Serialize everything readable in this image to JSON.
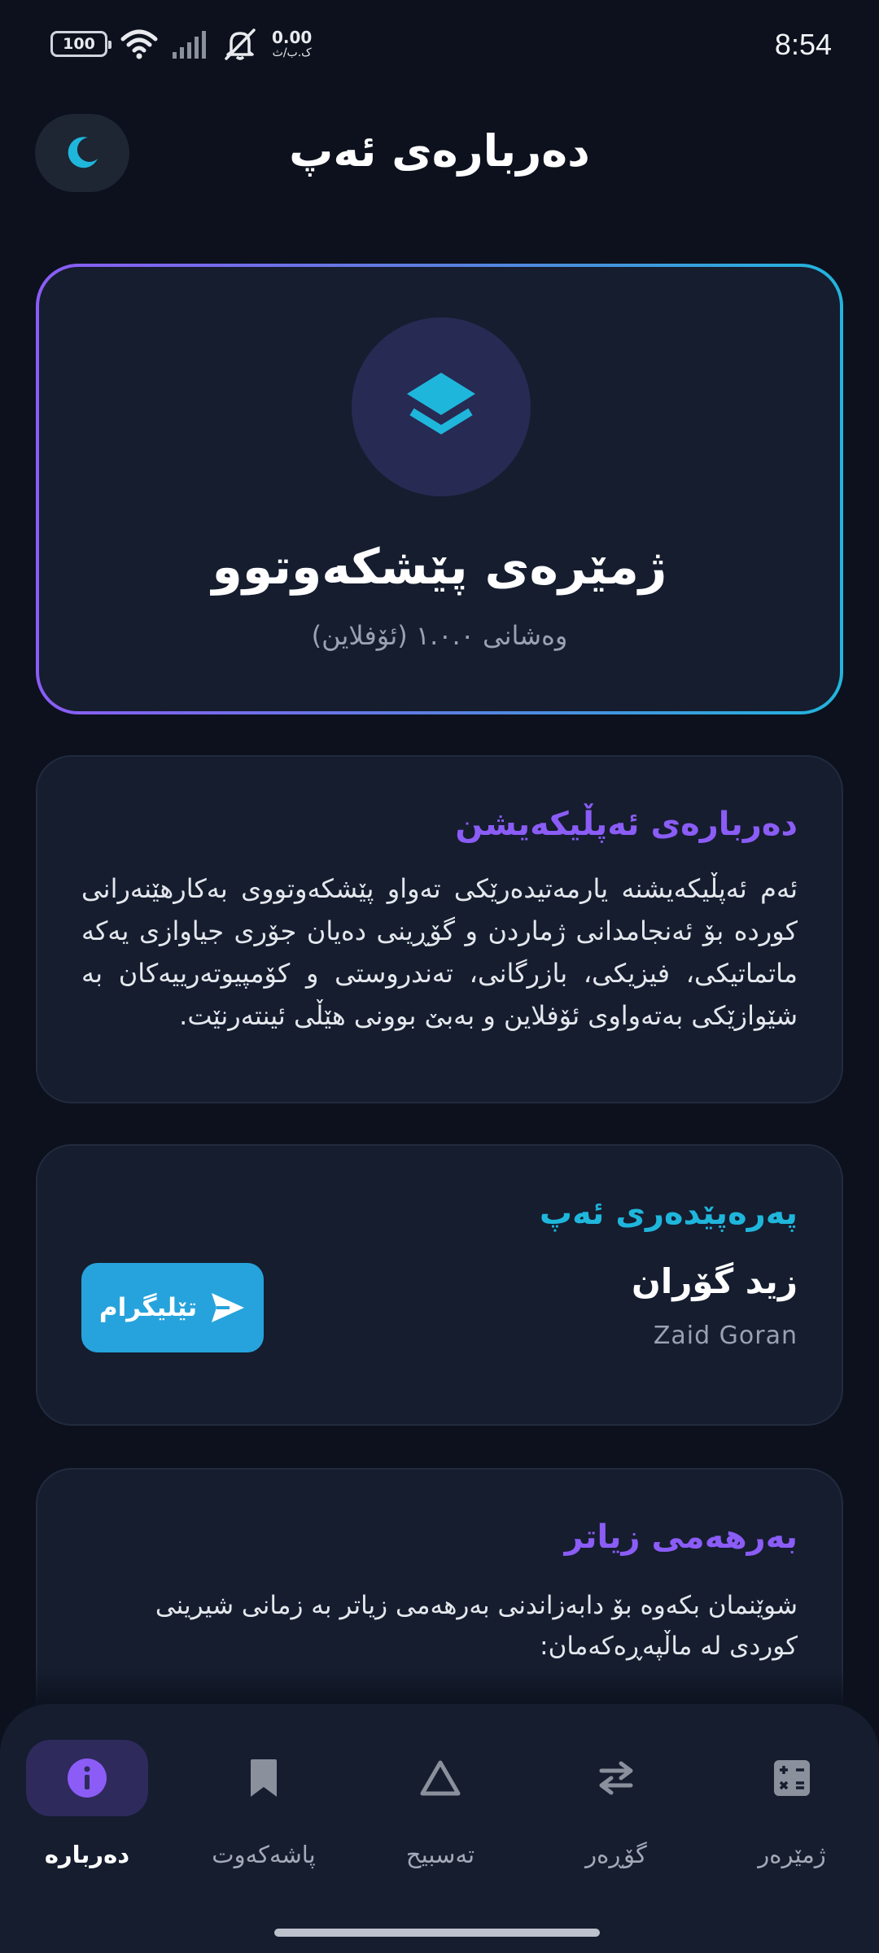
{
  "status_bar": {
    "battery": "100",
    "net_speed": "0.00",
    "net_unit": "ک.ب/ث",
    "time": "8:54",
    "icons": [
      "wifi-icon",
      "signal-icon",
      "mute-bell-icon"
    ]
  },
  "header": {
    "title": "دەربارەی ئەپ",
    "theme_icon": "moon-icon"
  },
  "hero": {
    "icon": "layers-icon",
    "app_name": "ژمێرەی پێشکەوتوو",
    "version": "وەشانی ١.٠.٠ (ئۆفلاین)"
  },
  "about": {
    "heading": "دەربارەی ئەپڵیکەیشن",
    "text": "ئەم ئەپڵیکەیشنە یارمەتیدەرێکی تەواو پێشکەوتووی بەکارهێنەرانی کوردە بۆ ئەنجامدانی ژماردن و گۆڕینی دەیان جۆری جیاوازی یەکە ماتماتیکی، فیزیکی، بازرگانی، تەندروستی و کۆمپیوتەرییەکان بە شێوازێکی بەتەواوی ئۆفلاین و بەبێ بوونی هێڵی ئینتەرنێت."
  },
  "developer": {
    "heading": "پەرەپێدەری ئەپ",
    "name": "زید گۆران",
    "name_latin": "Zaid Goran",
    "telegram_label": "تێلیگرام",
    "telegram_icon": "send-icon"
  },
  "more": {
    "heading": "بەرهەمی زیاتر",
    "text": "شوێنمان بکەوە بۆ دابەزاندنی بەرهەمی زیاتر بە زمانی شیرینی کوردی لە ماڵپەڕەکەمان:"
  },
  "bottom_nav": {
    "items": [
      {
        "label": "دەربارە",
        "icon": "info-icon",
        "active": true
      },
      {
        "label": "پاشەکەوت",
        "icon": "bookmark-icon",
        "active": false
      },
      {
        "label": "تەسبیح",
        "icon": "triangle-icon",
        "active": false
      },
      {
        "label": "گۆڕەر",
        "icon": "swap-icon",
        "active": false
      },
      {
        "label": "ژمێرەر",
        "icon": "calculator-icon",
        "active": false
      }
    ]
  },
  "colors": {
    "background": "#0c111d",
    "card": "#151d2f",
    "accent_purple": "#8b5cf6",
    "accent_cyan": "#1fb6dc",
    "telegram": "#26a3dc"
  }
}
